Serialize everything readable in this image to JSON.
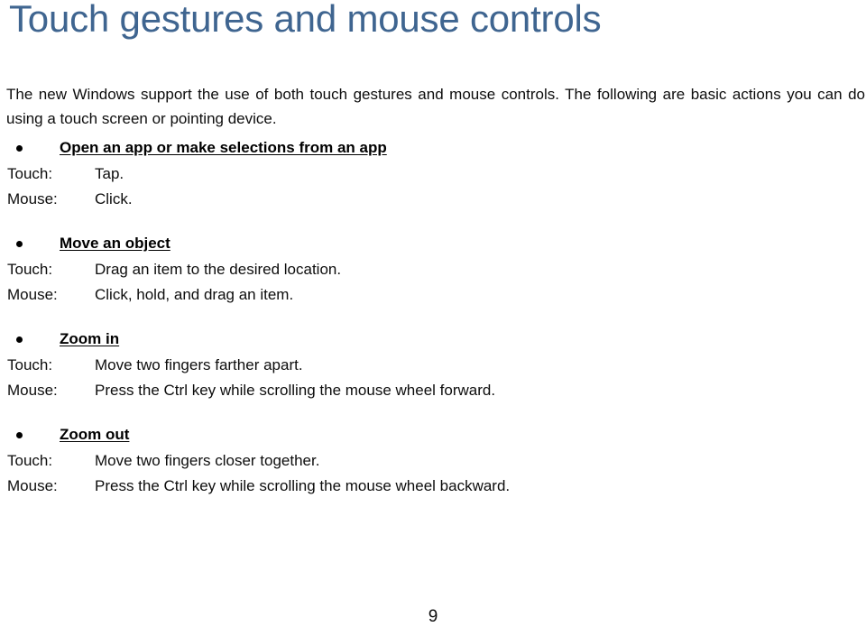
{
  "document": {
    "title": "Touch gestures and mouse controls",
    "title_color": "#3f6590",
    "intro": "The new Windows support the use of both touch gestures and mouse controls. The following are basic actions you can do using a touch screen or pointing device.",
    "page_number": "9",
    "sections": [
      {
        "heading": "Open an app or make selections from an app",
        "touch_label": "Touch:",
        "touch_value": "Tap.",
        "mouse_label": "Mouse:",
        "mouse_value": "Click."
      },
      {
        "heading": "Move an object",
        "touch_label": "Touch:",
        "touch_value": "Drag an item to the desired location.",
        "mouse_label": "Mouse:",
        "mouse_value": "Click, hold, and drag an item."
      },
      {
        "heading": "Zoom in",
        "touch_label": "Touch:",
        "touch_value": "Move two fingers farther apart.",
        "mouse_label": "Mouse:",
        "mouse_value": "Press the Ctrl key while scrolling the mouse wheel forward."
      },
      {
        "heading": "Zoom out",
        "touch_label": "Touch:",
        "touch_value": "Move two fingers closer together.",
        "mouse_label": "Mouse:",
        "mouse_value": "Press the Ctrl key while scrolling the mouse wheel backward."
      }
    ]
  }
}
